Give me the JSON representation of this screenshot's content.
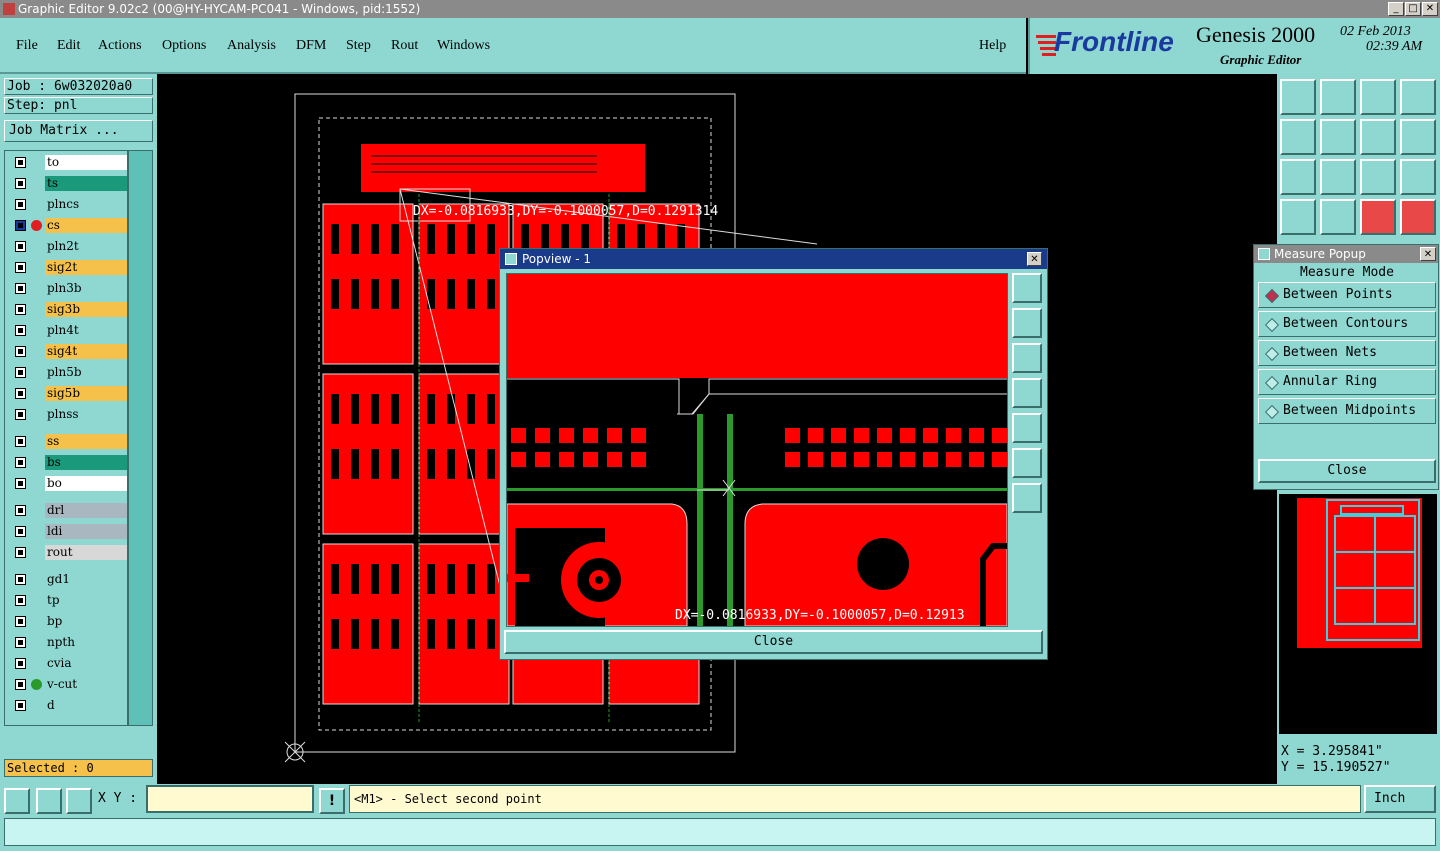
{
  "window": {
    "title": "Graphic Editor 9.02c2 (00@HY-HYCAM-PC041 - Windows, pid:1552)",
    "min_label": "_",
    "max_label": "□",
    "close_label": "✕"
  },
  "menu": [
    "File",
    "Edit",
    "Actions",
    "Options",
    "Analysis",
    "DFM",
    "Step",
    "Rout",
    "Windows"
  ],
  "help_label": "Help",
  "branding": {
    "logo": "Frontline",
    "product": "Genesis 2000",
    "subtitle": "Graphic Editor",
    "date": "02 Feb 2013",
    "time": "02:39 AM"
  },
  "job": {
    "job_line": "Job : 6w032020a0",
    "step_line": "Step: pnl",
    "matrix_button": "Job Matrix ..."
  },
  "layers": [
    {
      "name": "to",
      "color": "#ffffff",
      "dot": ""
    },
    {
      "name": "ts",
      "color": "#1a9a7a",
      "dot": ""
    },
    {
      "name": "plncs",
      "color": "#8fd8d2",
      "dot": ""
    },
    {
      "name": "cs",
      "color": "#f6c14a",
      "dot": "#e02020",
      "active": true
    },
    {
      "name": "pln2t",
      "color": "#8fd8d2",
      "dot": ""
    },
    {
      "name": "sig2t",
      "color": "#f6c14a",
      "dot": ""
    },
    {
      "name": "pln3b",
      "color": "#8fd8d2",
      "dot": ""
    },
    {
      "name": "sig3b",
      "color": "#f6c14a",
      "dot": ""
    },
    {
      "name": "pln4t",
      "color": "#8fd8d2",
      "dot": ""
    },
    {
      "name": "sig4t",
      "color": "#f6c14a",
      "dot": ""
    },
    {
      "name": "pln5b",
      "color": "#8fd8d2",
      "dot": ""
    },
    {
      "name": "sig5b",
      "color": "#f6c14a",
      "dot": ""
    },
    {
      "name": "plnss",
      "color": "#8fd8d2",
      "dot": ""
    },
    {
      "name": "ss",
      "color": "#f6c14a",
      "dot": ""
    },
    {
      "name": "bs",
      "color": "#1a9a7a",
      "dot": ""
    },
    {
      "name": "bo",
      "color": "#ffffff",
      "dot": ""
    },
    {
      "name": "drl",
      "color": "#a9b8c0",
      "dot": ""
    },
    {
      "name": "ldi",
      "color": "#a9b8c0",
      "dot": ""
    },
    {
      "name": "rout",
      "color": "#d8d8d8",
      "dot": ""
    },
    {
      "name": "gd1",
      "color": "#8fd8d2",
      "dot": ""
    },
    {
      "name": "tp",
      "color": "#8fd8d2",
      "dot": ""
    },
    {
      "name": "bp",
      "color": "#8fd8d2",
      "dot": ""
    },
    {
      "name": "npth",
      "color": "#8fd8d2",
      "dot": ""
    },
    {
      "name": "cvia",
      "color": "#8fd8d2",
      "dot": ""
    },
    {
      "name": "v-cut",
      "color": "#8fd8d2",
      "dot": "#2a9a2a"
    },
    {
      "name": "d",
      "color": "#8fd8d2",
      "dot": ""
    }
  ],
  "selected_label": "Selected : 0",
  "measurement_text": "DX=-0.0816933,DY=-0.1000057,D=0.1291314",
  "popview": {
    "title": "Popview - 1",
    "measurement": "DX=-0.0816933,DY=-0.1000057,D=0.12913",
    "close_label": "Close"
  },
  "measure_popup": {
    "title": "Measure Popup",
    "heading": "Measure Mode",
    "options": [
      {
        "label": "Between Points",
        "selected": true
      },
      {
        "label": "Between Contours",
        "selected": false
      },
      {
        "label": "Between Nets",
        "selected": false
      },
      {
        "label": "Annular Ring",
        "selected": false
      },
      {
        "label": "Between Midpoints",
        "selected": false
      }
    ],
    "close_label": "Close"
  },
  "toolbar_icons": [
    "next-step-icon",
    "zoom-home-icon",
    "home-icon",
    "window-icon",
    "pan-left-icon",
    "pan-right-icon",
    "flip-icon",
    "redo-icon",
    "fit-icon",
    "center-icon",
    "one-to-two-icon",
    "help-icon",
    "measure-icon",
    "grid-icon",
    "layer-red-icon",
    "layer-red2-icon"
  ],
  "coords": {
    "x": "X  =  3.295841\"",
    "y": "Y  =  15.190527\""
  },
  "bottom": {
    "xy_label": "X Y :",
    "prompt": "<M1> - Select second point",
    "units": "Inch",
    "warning_label": "!"
  }
}
